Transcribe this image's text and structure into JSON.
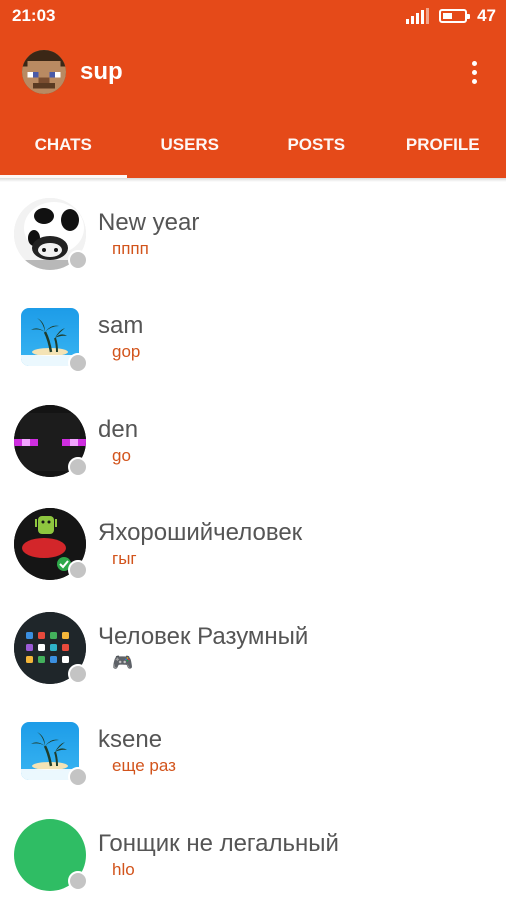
{
  "status_bar": {
    "time": "21:03",
    "battery_level": "47",
    "battery_fraction": 0.47
  },
  "app_bar": {
    "title": "sup",
    "menu_icon": "more-vert-icon"
  },
  "tabs": [
    {
      "label": "CHATS",
      "active": true
    },
    {
      "label": "USERS",
      "active": false
    },
    {
      "label": "POSTS",
      "active": false
    },
    {
      "label": "PROFILE",
      "active": false
    }
  ],
  "chats": [
    {
      "name": "New year",
      "last_message": "пппп",
      "avatar": "cow-avatar",
      "online": false
    },
    {
      "name": "sam",
      "last_message": "gop",
      "avatar": "beach-avatar",
      "online": false
    },
    {
      "name": "den",
      "last_message": "go",
      "avatar": "enderman-avatar",
      "online": false
    },
    {
      "name": "Яхорошийчеловек",
      "last_message": "гыг",
      "avatar": "android-avatar",
      "online": false
    },
    {
      "name": "Человек Разумный",
      "last_message": "🎮",
      "avatar": "app-grid-avatar",
      "online": false
    },
    {
      "name": "ksene",
      "last_message": "еще раз",
      "avatar": "beach-avatar",
      "online": false
    },
    {
      "name": "Гонщик не легальный",
      "last_message": "hlo",
      "avatar": "green-circle-avatar",
      "online": false
    }
  ],
  "colors": {
    "primary": "#e54a19",
    "message_text": "#d2541c",
    "name_text": "#555555",
    "offline_dot": "#c4c4c4"
  }
}
